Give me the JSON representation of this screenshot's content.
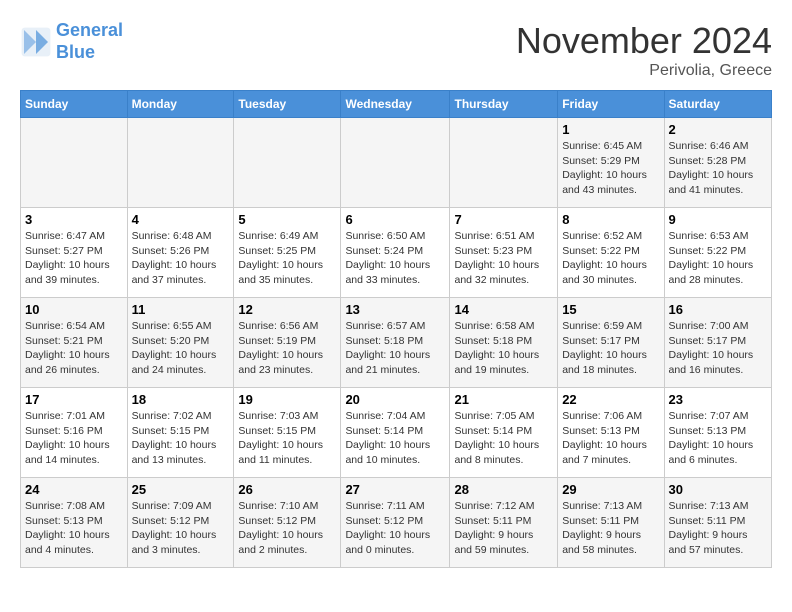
{
  "header": {
    "logo_line1": "General",
    "logo_line2": "Blue",
    "month": "November 2024",
    "location": "Perivolia, Greece"
  },
  "days_of_week": [
    "Sunday",
    "Monday",
    "Tuesday",
    "Wednesday",
    "Thursday",
    "Friday",
    "Saturday"
  ],
  "weeks": [
    {
      "days": [
        {
          "num": "",
          "info": ""
        },
        {
          "num": "",
          "info": ""
        },
        {
          "num": "",
          "info": ""
        },
        {
          "num": "",
          "info": ""
        },
        {
          "num": "",
          "info": ""
        },
        {
          "num": "1",
          "info": "Sunrise: 6:45 AM\nSunset: 5:29 PM\nDaylight: 10 hours\nand 43 minutes."
        },
        {
          "num": "2",
          "info": "Sunrise: 6:46 AM\nSunset: 5:28 PM\nDaylight: 10 hours\nand 41 minutes."
        }
      ]
    },
    {
      "days": [
        {
          "num": "3",
          "info": "Sunrise: 6:47 AM\nSunset: 5:27 PM\nDaylight: 10 hours\nand 39 minutes."
        },
        {
          "num": "4",
          "info": "Sunrise: 6:48 AM\nSunset: 5:26 PM\nDaylight: 10 hours\nand 37 minutes."
        },
        {
          "num": "5",
          "info": "Sunrise: 6:49 AM\nSunset: 5:25 PM\nDaylight: 10 hours\nand 35 minutes."
        },
        {
          "num": "6",
          "info": "Sunrise: 6:50 AM\nSunset: 5:24 PM\nDaylight: 10 hours\nand 33 minutes."
        },
        {
          "num": "7",
          "info": "Sunrise: 6:51 AM\nSunset: 5:23 PM\nDaylight: 10 hours\nand 32 minutes."
        },
        {
          "num": "8",
          "info": "Sunrise: 6:52 AM\nSunset: 5:22 PM\nDaylight: 10 hours\nand 30 minutes."
        },
        {
          "num": "9",
          "info": "Sunrise: 6:53 AM\nSunset: 5:22 PM\nDaylight: 10 hours\nand 28 minutes."
        }
      ]
    },
    {
      "days": [
        {
          "num": "10",
          "info": "Sunrise: 6:54 AM\nSunset: 5:21 PM\nDaylight: 10 hours\nand 26 minutes."
        },
        {
          "num": "11",
          "info": "Sunrise: 6:55 AM\nSunset: 5:20 PM\nDaylight: 10 hours\nand 24 minutes."
        },
        {
          "num": "12",
          "info": "Sunrise: 6:56 AM\nSunset: 5:19 PM\nDaylight: 10 hours\nand 23 minutes."
        },
        {
          "num": "13",
          "info": "Sunrise: 6:57 AM\nSunset: 5:18 PM\nDaylight: 10 hours\nand 21 minutes."
        },
        {
          "num": "14",
          "info": "Sunrise: 6:58 AM\nSunset: 5:18 PM\nDaylight: 10 hours\nand 19 minutes."
        },
        {
          "num": "15",
          "info": "Sunrise: 6:59 AM\nSunset: 5:17 PM\nDaylight: 10 hours\nand 18 minutes."
        },
        {
          "num": "16",
          "info": "Sunrise: 7:00 AM\nSunset: 5:17 PM\nDaylight: 10 hours\nand 16 minutes."
        }
      ]
    },
    {
      "days": [
        {
          "num": "17",
          "info": "Sunrise: 7:01 AM\nSunset: 5:16 PM\nDaylight: 10 hours\nand 14 minutes."
        },
        {
          "num": "18",
          "info": "Sunrise: 7:02 AM\nSunset: 5:15 PM\nDaylight: 10 hours\nand 13 minutes."
        },
        {
          "num": "19",
          "info": "Sunrise: 7:03 AM\nSunset: 5:15 PM\nDaylight: 10 hours\nand 11 minutes."
        },
        {
          "num": "20",
          "info": "Sunrise: 7:04 AM\nSunset: 5:14 PM\nDaylight: 10 hours\nand 10 minutes."
        },
        {
          "num": "21",
          "info": "Sunrise: 7:05 AM\nSunset: 5:14 PM\nDaylight: 10 hours\nand 8 minutes."
        },
        {
          "num": "22",
          "info": "Sunrise: 7:06 AM\nSunset: 5:13 PM\nDaylight: 10 hours\nand 7 minutes."
        },
        {
          "num": "23",
          "info": "Sunrise: 7:07 AM\nSunset: 5:13 PM\nDaylight: 10 hours\nand 6 minutes."
        }
      ]
    },
    {
      "days": [
        {
          "num": "24",
          "info": "Sunrise: 7:08 AM\nSunset: 5:13 PM\nDaylight: 10 hours\nand 4 minutes."
        },
        {
          "num": "25",
          "info": "Sunrise: 7:09 AM\nSunset: 5:12 PM\nDaylight: 10 hours\nand 3 minutes."
        },
        {
          "num": "26",
          "info": "Sunrise: 7:10 AM\nSunset: 5:12 PM\nDaylight: 10 hours\nand 2 minutes."
        },
        {
          "num": "27",
          "info": "Sunrise: 7:11 AM\nSunset: 5:12 PM\nDaylight: 10 hours\nand 0 minutes."
        },
        {
          "num": "28",
          "info": "Sunrise: 7:12 AM\nSunset: 5:11 PM\nDaylight: 9 hours\nand 59 minutes."
        },
        {
          "num": "29",
          "info": "Sunrise: 7:13 AM\nSunset: 5:11 PM\nDaylight: 9 hours\nand 58 minutes."
        },
        {
          "num": "30",
          "info": "Sunrise: 7:13 AM\nSunset: 5:11 PM\nDaylight: 9 hours\nand 57 minutes."
        }
      ]
    }
  ]
}
